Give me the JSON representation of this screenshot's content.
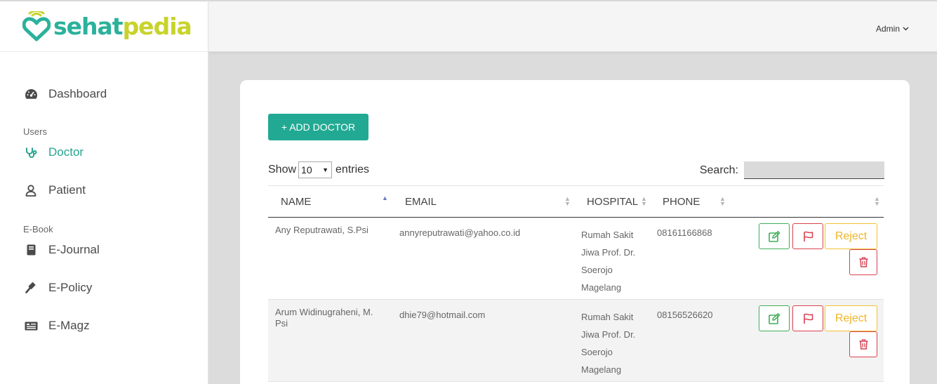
{
  "brand": {
    "text_a": "sehat",
    "text_b": "pedia"
  },
  "user_menu": {
    "label": "Admin",
    "icon": "chevron-down-icon"
  },
  "sidebar": {
    "dashboard": {
      "label": "Dashboard",
      "icon": "dashboard-icon"
    },
    "section_users": "Users",
    "doctor": {
      "label": "Doctor",
      "icon": "stethoscope-icon",
      "active": true
    },
    "patient": {
      "label": "Patient",
      "icon": "user-icon"
    },
    "section_ebook": "E-Book",
    "ejournal": {
      "label": "E-Journal",
      "icon": "book-icon"
    },
    "epolicy": {
      "label": "E-Policy",
      "icon": "gavel-icon"
    },
    "emagz": {
      "label": "E-Magz",
      "icon": "newspaper-icon"
    }
  },
  "main": {
    "add_button": "+ ADD DOCTOR",
    "show_label": "Show",
    "entries_value": "10",
    "entries_label": "entries",
    "search_label": "Search:",
    "search_value": ""
  },
  "table": {
    "columns": [
      "NAME",
      "EMAIL",
      "HOSPITAL",
      "PHONE"
    ],
    "sorted_column": "NAME",
    "rows": [
      {
        "name": "Any Reputrawati, S.Psi",
        "email": "annyreputrawati@yahoo.co.id",
        "hospital": [
          "Rumah Sakit",
          "Jiwa Prof. Dr.",
          "Soerojo",
          "Magelang"
        ],
        "phone": "08161166868",
        "reject": "Reject"
      },
      {
        "name": "Arum Widinugraheni, M. Psi",
        "email": "dhie79@hotmail.com",
        "hospital": [
          "Rumah Sakit",
          "Jiwa Prof. Dr.",
          "Soerojo",
          "Magelang"
        ],
        "phone": "08156526620",
        "reject": "Reject"
      }
    ]
  },
  "colors": {
    "accent": "#22a993",
    "active_nav": "#27a48f",
    "edit": "#3fae58",
    "danger": "#d9404f",
    "warning": "#f0b429",
    "brand_green": "#2bb19c",
    "brand_lime": "#c8d32b"
  }
}
